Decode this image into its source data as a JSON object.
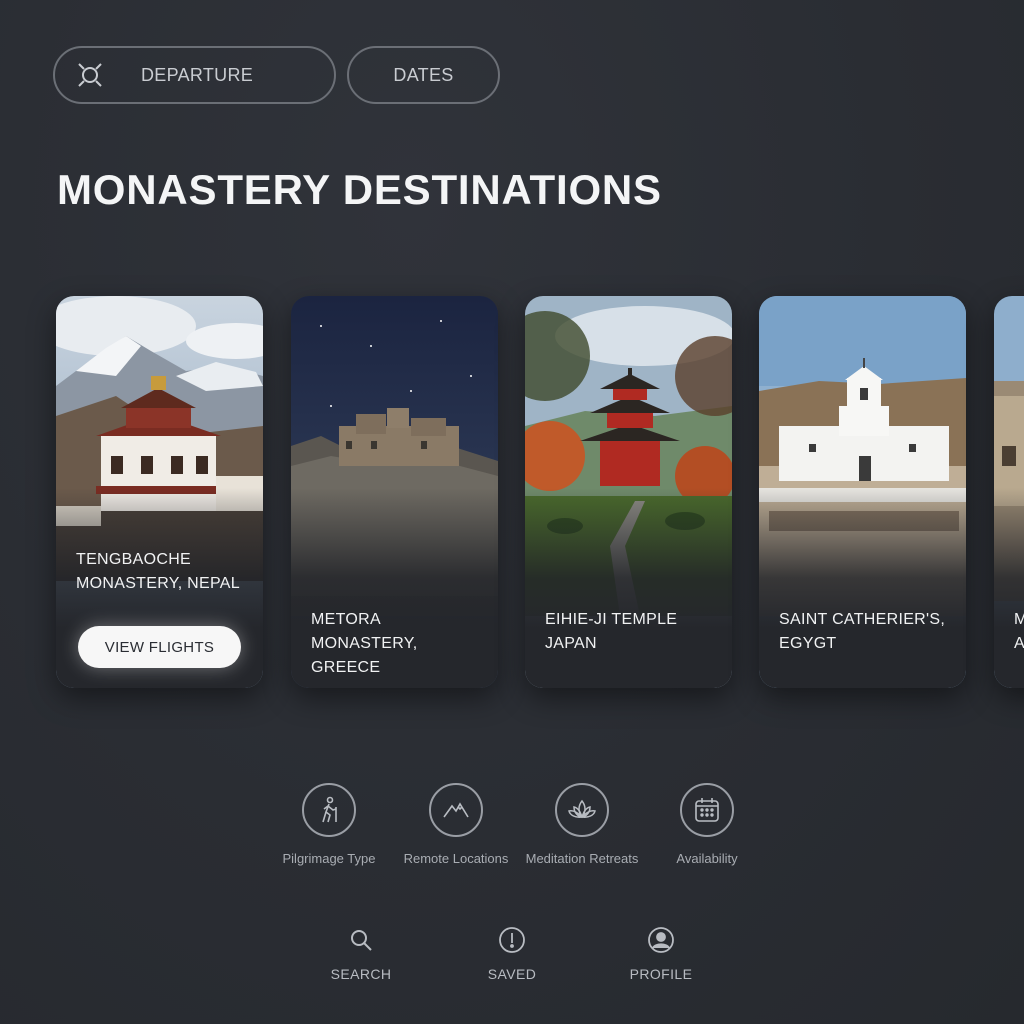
{
  "filters": {
    "departure_label": "DEPARTURE",
    "dates_label": "DATES"
  },
  "page_title": "MONASTERY DESTINATIONS",
  "destinations": [
    {
      "line1": "TENGBAOCHE",
      "line2": "MONASTERY, NEPAL",
      "button": "VIEW FLIGHTS"
    },
    {
      "line1": "METORA MONASTERY,",
      "line2": "GREECE"
    },
    {
      "line1": "EIHIE-JI TEMPLE",
      "line2": "JAPAN"
    },
    {
      "line1": "SAINT CATHERIER'S,",
      "line2": "EGYGT"
    },
    {
      "line1": "M",
      "line2": "A"
    }
  ],
  "categories": [
    {
      "label": "Pilgrimage Type",
      "icon": "hiker-icon"
    },
    {
      "label": "Remote Locations",
      "icon": "mountain-icon"
    },
    {
      "label": "Meditation Retreats",
      "icon": "lotus-icon"
    },
    {
      "label": "Availability",
      "icon": "calendar-icon"
    }
  ],
  "nav": {
    "search": "SEARCH",
    "saved": "SAVED",
    "profile": "PROFILE"
  },
  "colors": {
    "background": "#2a2d33",
    "button_bg": "#f7f7f7",
    "text_primary": "#f4f5f6",
    "text_muted": "#a9adb3"
  }
}
